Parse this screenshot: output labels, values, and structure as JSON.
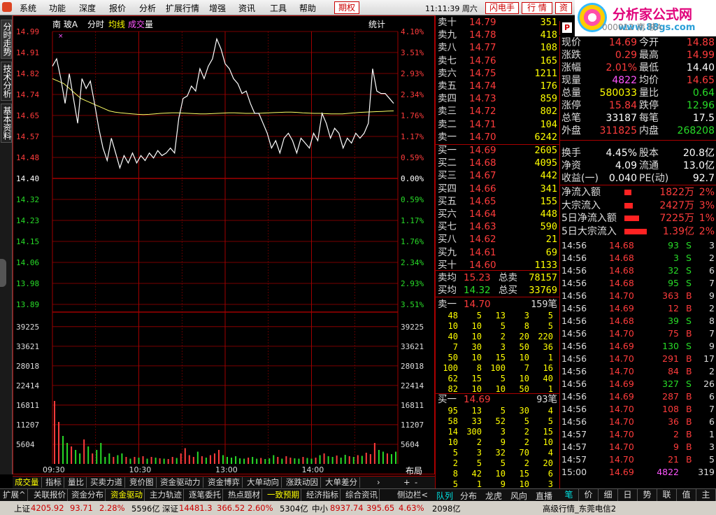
{
  "menu": {
    "items": [
      "系统",
      "功能",
      "深度",
      "报价",
      "分析",
      "扩展行情",
      "增强",
      "资讯",
      "工具",
      "帮助"
    ],
    "active": "期权",
    "clock": "11:11:39 周六",
    "btn_flash": "闪电手",
    "btn_market": "行 情",
    "btn_info": "资"
  },
  "logo": {
    "title": "分析家公式网",
    "url": "www.88gs.com",
    "under": "000012 南 玻A"
  },
  "left_tabs": [
    "分时走势",
    "技术分析",
    "基本资料"
  ],
  "chart_header": {
    "stock": "南 玻A",
    "mode": "分时",
    "avg": "均线",
    "vol1": "成交",
    "vol2": "量",
    "stat": "统计"
  },
  "chart_data": {
    "type": "line",
    "prev_close": 14.4,
    "price_ticks": [
      "14.99",
      "14.91",
      "14.82",
      "14.74",
      "14.65",
      "14.57",
      "14.48",
      "14.40",
      "14.32",
      "14.23",
      "14.15",
      "14.06",
      "13.98",
      "13.89"
    ],
    "pct_ticks": [
      "4.10%",
      "3.51%",
      "2.93%",
      "2.34%",
      "1.76%",
      "1.17%",
      "0.59%",
      "0.00%",
      "0.59%",
      "1.17%",
      "1.76%",
      "2.34%",
      "2.93%",
      "3.51%"
    ],
    "vol_ticks": [
      "39225",
      "33621",
      "28018",
      "22414",
      "16811",
      "11207",
      "5604"
    ],
    "time_ticks": [
      "09:30",
      "10:30",
      "13:00",
      "14:00"
    ],
    "price": [
      14.85,
      14.88,
      14.8,
      14.7,
      14.82,
      14.72,
      14.62,
      14.8,
      14.76,
      14.79,
      14.7,
      14.6,
      14.52,
      14.47,
      14.56,
      14.5,
      14.44,
      14.49,
      14.46,
      14.5,
      14.46,
      14.49,
      14.47,
      14.5,
      14.48,
      14.51,
      14.49,
      14.5,
      14.52,
      14.5,
      14.64,
      14.72,
      14.73,
      14.77,
      14.75,
      14.84,
      14.8,
      14.85,
      14.88,
      14.96,
      14.92,
      14.86,
      14.84,
      14.8,
      14.78,
      14.74,
      14.75,
      14.7,
      14.66,
      14.66,
      14.62,
      14.58,
      14.52,
      14.55,
      14.5,
      14.56,
      14.58,
      14.55,
      14.5,
      14.56,
      14.54,
      14.52,
      14.58,
      14.55,
      14.66,
      14.62,
      14.56,
      14.6,
      14.58,
      14.52,
      14.56,
      14.54,
      14.58,
      14.56,
      14.58,
      14.62,
      14.84,
      14.75,
      14.74,
      14.74,
      14.72,
      14.7
    ],
    "avg": [
      14.8,
      14.79,
      14.78,
      14.76,
      14.74,
      14.72,
      14.71,
      14.7,
      14.69,
      14.68,
      14.67,
      14.665,
      14.662,
      14.66,
      14.658,
      14.656,
      14.655,
      14.656,
      14.658,
      14.66,
      14.661,
      14.662,
      14.662,
      14.661,
      14.66,
      14.659,
      14.658,
      14.658,
      14.659,
      14.66,
      14.661,
      14.662,
      14.662,
      14.661,
      14.66,
      14.66,
      14.66,
      14.661,
      14.662,
      14.663,
      14.664,
      14.665,
      14.665,
      14.664,
      14.662,
      14.661,
      14.66,
      14.66,
      14.659,
      14.658,
      14.658,
      14.658,
      14.66,
      14.662,
      14.664,
      14.665,
      14.666,
      14.667,
      14.668,
      14.669,
      14.67
    ],
    "volume": [
      18000,
      12000,
      8000,
      6000,
      5000,
      4000,
      3000,
      7000,
      5000,
      3000,
      4000,
      6000,
      2000,
      3000,
      2000,
      2500,
      3000,
      2000,
      1500,
      2000,
      1800,
      2200,
      1500,
      2000,
      1800,
      1600,
      1500,
      1400,
      2000,
      1700,
      3000,
      4500,
      2500,
      2000,
      3500,
      2200,
      1800,
      2500,
      3000,
      4000,
      2500,
      2000,
      1800,
      2200,
      1600,
      1500,
      1800,
      2000,
      1500,
      1700,
      1400,
      1600,
      2500,
      2000,
      1500,
      2200,
      1800,
      1600,
      1500,
      2000,
      1700,
      1500,
      1800,
      2500,
      3000,
      2200,
      2000,
      2400,
      1800,
      2600,
      2200,
      2000,
      2500,
      2300,
      3200,
      2800,
      6000,
      4000,
      3500,
      3000,
      2800,
      3500
    ]
  },
  "bottom_tabs": [
    "成交量",
    "指标",
    "量比",
    "买卖力道",
    "竞价图",
    "资金驱动力",
    "资金博弈",
    "大单动向",
    "涨跌动因",
    "大单差分"
  ],
  "bottom_ctrl": [
    "+",
    "-",
    "布局"
  ],
  "nav_row": [
    "扩展^",
    "关联报价",
    "资金分布",
    "资金驱动",
    "主力轨迹",
    "逐笔委托",
    "热点题材",
    "一致预期",
    "经济指标",
    "综合资讯",
    "侧边栏<"
  ],
  "book": {
    "asks": [
      {
        "l": "卖十",
        "p": "14.79",
        "v": "351"
      },
      {
        "l": "卖九",
        "p": "14.78",
        "v": "418"
      },
      {
        "l": "卖八",
        "p": "14.77",
        "v": "108"
      },
      {
        "l": "卖七",
        "p": "14.76",
        "v": "165"
      },
      {
        "l": "卖六",
        "p": "14.75",
        "v": "1211"
      },
      {
        "l": "卖五",
        "p": "14.74",
        "v": "176"
      },
      {
        "l": "卖四",
        "p": "14.73",
        "v": "859"
      },
      {
        "l": "卖三",
        "p": "14.72",
        "v": "802"
      },
      {
        "l": "卖二",
        "p": "14.71",
        "v": "104"
      },
      {
        "l": "卖一",
        "p": "14.70",
        "v": "6242"
      }
    ],
    "bids": [
      {
        "l": "买一",
        "p": "14.69",
        "v": "2605"
      },
      {
        "l": "买二",
        "p": "14.68",
        "v": "4095"
      },
      {
        "l": "买三",
        "p": "14.67",
        "v": "442"
      },
      {
        "l": "买四",
        "p": "14.66",
        "v": "341"
      },
      {
        "l": "买五",
        "p": "14.65",
        "v": "155"
      },
      {
        "l": "买六",
        "p": "14.64",
        "v": "448"
      },
      {
        "l": "买七",
        "p": "14.63",
        "v": "590"
      },
      {
        "l": "买八",
        "p": "14.62",
        "v": "21"
      },
      {
        "l": "买九",
        "p": "14.61",
        "v": "69"
      },
      {
        "l": "买十",
        "p": "14.60",
        "v": "1133"
      }
    ],
    "avg_sell": {
      "l": "卖均",
      "p": "15.23",
      "k": "总卖",
      "v": "78157"
    },
    "avg_buy": {
      "l": "买均",
      "p": "14.32",
      "k": "总买",
      "v": "33769"
    },
    "sell1_head": {
      "l": "卖一",
      "p": "14.70",
      "v": "159笔"
    },
    "sell1_queue": [
      [
        "48",
        "5",
        "13",
        "3",
        "5"
      ],
      [
        "10",
        "10",
        "5",
        "8",
        "5"
      ],
      [
        "40",
        "10",
        "2",
        "20",
        "220"
      ],
      [
        "7",
        "30",
        "3",
        "50",
        "36"
      ],
      [
        "50",
        "10",
        "15",
        "10",
        "1"
      ],
      [
        "100",
        "8",
        "100",
        "7",
        "16"
      ],
      [
        "62",
        "15",
        "5",
        "10",
        "40"
      ],
      [
        "82",
        "10",
        "10",
        "50",
        "1"
      ]
    ],
    "buy1_head": {
      "l": "买一",
      "p": "14.69",
      "v": "93笔"
    },
    "buy1_queue": [
      [
        "95",
        "13",
        "5",
        "30",
        "4"
      ],
      [
        "58",
        "33",
        "52",
        "5",
        "5"
      ],
      [
        "14",
        "300",
        "3",
        "2",
        "15"
      ],
      [
        "10",
        "2",
        "9",
        "2",
        "10"
      ],
      [
        "5",
        "3",
        "32",
        "70",
        "4"
      ],
      [
        "2",
        "5",
        "5",
        "2",
        "20"
      ],
      [
        "8",
        "42",
        "10",
        "15",
        "6"
      ],
      [
        "5",
        "1",
        "9",
        "10",
        "3"
      ]
    ]
  },
  "info": {
    "rows": [
      {
        "k1": "现价",
        "v1": "14.69",
        "c1": "red",
        "k2": "今开",
        "v2": "14.88",
        "c2": "red"
      },
      {
        "k1": "涨跌",
        "v1": "0.29",
        "c1": "red",
        "k2": "最高",
        "v2": "14.99",
        "c2": "red"
      },
      {
        "k1": "涨幅",
        "v1": "2.01%",
        "c1": "red",
        "k2": "最低",
        "v2": "14.40",
        "c2": "white"
      },
      {
        "k1": "现量",
        "v1": "4822",
        "c1": "mag",
        "k2": "均价",
        "v2": "14.65",
        "c2": "red"
      },
      {
        "k1": "总量",
        "v1": "580033",
        "c1": "yellow",
        "k2": "量比",
        "v2": "0.64",
        "c2": "green"
      },
      {
        "k1": "涨停",
        "v1": "15.84",
        "c1": "red",
        "k2": "跌停",
        "v2": "12.96",
        "c2": "green"
      },
      {
        "k1": "总笔",
        "v1": "33187",
        "c1": "white",
        "k2": "每笔",
        "v2": "17.5",
        "c2": "white"
      },
      {
        "k1": "外盘",
        "v1": "311825",
        "c1": "red",
        "k2": "内盘",
        "v2": "268208",
        "c2": "green"
      },
      {
        "k1": "换手",
        "v1": "4.45%",
        "c1": "white",
        "k2": "股本",
        "v2": "20.8亿",
        "c2": "white"
      },
      {
        "k1": "净资",
        "v1": "4.09",
        "c1": "white",
        "k2": "流通",
        "v2": "13.0亿",
        "c2": "white"
      },
      {
        "k1": "收益(一)",
        "v1": "0.040",
        "c1": "white",
        "k2": "PE(动)",
        "v2": "92.7",
        "c2": "white"
      }
    ],
    "flows": [
      {
        "k": "净流入额",
        "v": "1822万",
        "p": "2%",
        "bar": 0.2
      },
      {
        "k": "大宗流入",
        "v": "2427万",
        "p": "3%",
        "bar": 0.3
      },
      {
        "k": "5日净流入额",
        "v": "7225万",
        "p": "1%",
        "bar": 0.6
      },
      {
        "k": "5日大宗流入",
        "v": "1.39亿",
        "p": "2%",
        "bar": 1.0
      }
    ]
  },
  "ticks": [
    [
      "14:56",
      "14.68",
      "93",
      "S",
      "3"
    ],
    [
      "14:56",
      "14.68",
      "3",
      "S",
      "2"
    ],
    [
      "14:56",
      "14.68",
      "32",
      "S",
      "6"
    ],
    [
      "14:56",
      "14.68",
      "95",
      "S",
      "7"
    ],
    [
      "14:56",
      "14.70",
      "363",
      "B",
      "9"
    ],
    [
      "14:56",
      "14.69",
      "12",
      "B",
      "2"
    ],
    [
      "14:56",
      "14.68",
      "39",
      "S",
      "8"
    ],
    [
      "14:56",
      "14.70",
      "75",
      "B",
      "7"
    ],
    [
      "14:56",
      "14.69",
      "130",
      "S",
      "9"
    ],
    [
      "14:56",
      "14.70",
      "291",
      "B",
      "17"
    ],
    [
      "14:56",
      "14.70",
      "84",
      "B",
      "2"
    ],
    [
      "14:56",
      "14.69",
      "327",
      "S",
      "26"
    ],
    [
      "14:56",
      "14.69",
      "287",
      "B",
      "6"
    ],
    [
      "14:56",
      "14.70",
      "108",
      "B",
      "7"
    ],
    [
      "14:56",
      "14.70",
      "36",
      "B",
      "6"
    ],
    [
      "14:57",
      "14.70",
      "2",
      "B",
      "1"
    ],
    [
      "14:57",
      "14.70",
      "9",
      "B",
      "3"
    ],
    [
      "14:57",
      "14.70",
      "21",
      "B",
      "5"
    ],
    [
      "15:00",
      "14.69",
      "4822",
      "",
      "319"
    ]
  ],
  "right_tabs": [
    "笔",
    "价",
    "细",
    "日",
    "势",
    "联",
    "值",
    "主"
  ],
  "status": {
    "sh_name": "上证",
    "sh_val": "4205.92",
    "sh_chg": "93.71",
    "sh_pct": "2.28%",
    "sh_amt": "5596亿",
    "sz_name": "深证",
    "sz_val": "14481.3",
    "sz_chg": "366.52",
    "sz_pct": "2.60%",
    "sz_amt": "5304亿",
    "zx_name": "中小",
    "zx_val": "8937.74",
    "zx_chg": "395.65",
    "zx_pct": "4.63%",
    "zx_amt": "2098亿",
    "feed": "高级行情_东莞电信2"
  },
  "colors": {
    "up": "#ff3c3c",
    "down": "#28dc28",
    "avg_line": "#ffff66",
    "grid": "#a00000"
  }
}
